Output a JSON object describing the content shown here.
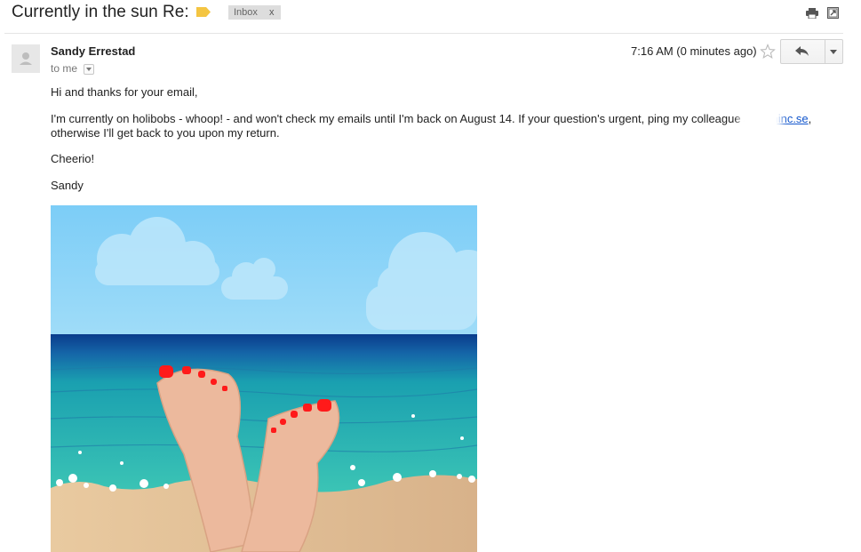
{
  "header": {
    "subject": "Currently in the sun Re:",
    "label_chip": "Inbox",
    "label_remove": "x",
    "label_tag_color": "#f4c542"
  },
  "message": {
    "sender": "Sandy Errestad",
    "recipient": "to me",
    "timestamp": "7:16 AM (0 minutes ago)",
    "greeting": "Hi and thanks for your email,",
    "body_part1": "I'm currently on holibobs - whoop! - and won't check my emails until I'm back on August 14. If your question's urgent, ping my colleague at ",
    "colleague_email": "@minc.se",
    "body_part2": ", otherwise I'll get back to you upon my return.",
    "signoff": "Cheerio!",
    "signature": "Sandy"
  },
  "icons": {
    "print": "print-icon",
    "new_window": "new-window-icon",
    "star": "star-icon",
    "reply": "reply-icon",
    "more": "chevron-down-icon",
    "avatar": "avatar-icon"
  },
  "colors": {
    "link": "#1155cc",
    "nail_polish": "#ff1a1a",
    "sky": "#7ecbf5",
    "sea": "#1fa8a8"
  }
}
